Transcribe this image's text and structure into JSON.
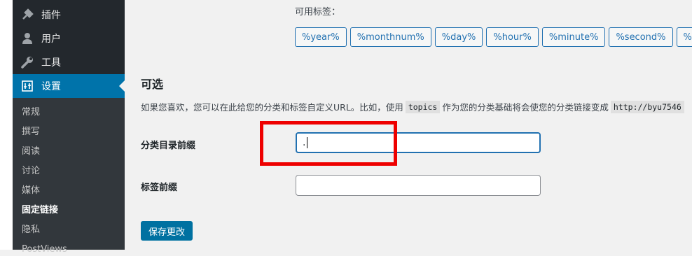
{
  "sidebar": {
    "items": [
      {
        "label": "插件",
        "icon": "plugin-icon"
      },
      {
        "label": "用户",
        "icon": "user-icon"
      },
      {
        "label": "工具",
        "icon": "wrench-icon"
      },
      {
        "label": "设置",
        "icon": "settings-icon"
      }
    ],
    "submenu": [
      "常规",
      "撰写",
      "阅读",
      "讨论",
      "媒体",
      "固定链接",
      "隐私",
      "PostViews"
    ],
    "current_submenu": "固定链接"
  },
  "main": {
    "available_tags_label": "可用标签：",
    "tags": [
      "%year%",
      "%monthnum%",
      "%day%",
      "%hour%",
      "%minute%",
      "%second%",
      "%p"
    ],
    "optional": {
      "title": "可选",
      "description_before": "如果您喜欢，您可以在此给您的分类和标签自定义URL。比如，使用",
      "code_example": "topics",
      "description_after": "作为您的分类基础将会使您的分类链接变成",
      "url_example": "http://byu7546"
    },
    "category_base": {
      "label": "分类目录前缀",
      "value": "."
    },
    "tag_base": {
      "label": "标签前缀",
      "value": ""
    },
    "save_button": "保存更改"
  },
  "colors": {
    "sidebar_bg": "#23282d",
    "submenu_bg": "#32373c",
    "active_bg": "#0073aa",
    "tag_border": "#2271b1",
    "highlight_box": "#ee0000"
  }
}
